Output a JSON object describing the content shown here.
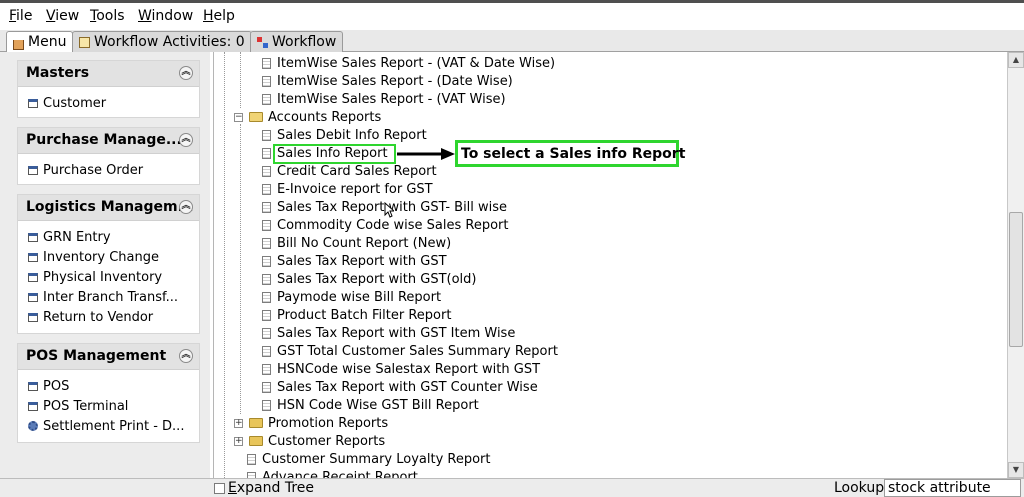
{
  "menubar": {
    "items": [
      {
        "first": "F",
        "rest": "ile"
      },
      {
        "first": "V",
        "rest": "iew"
      },
      {
        "first": "T",
        "rest": "ools"
      },
      {
        "first": "W",
        "rest": "indow"
      },
      {
        "first": "H",
        "rest": "elp"
      }
    ]
  },
  "tabs": [
    {
      "label": "Menu",
      "icon": "home-icon"
    },
    {
      "label": "Workflow Activities: 0",
      "icon": "calendar-icon"
    },
    {
      "label": "Workflow",
      "icon": "workflow-icon"
    }
  ],
  "sidebar": {
    "panels": [
      {
        "title": "Masters",
        "items": [
          {
            "label": "Customer"
          }
        ]
      },
      {
        "title": "Purchase Manage...",
        "items": [
          {
            "label": "Purchase Order"
          }
        ]
      },
      {
        "title": "Logistics Managem...",
        "items": [
          {
            "label": "GRN Entry"
          },
          {
            "label": "Inventory Change"
          },
          {
            "label": "Physical Inventory"
          },
          {
            "label": "Inter Branch Transf..."
          },
          {
            "label": "Return to Vendor"
          }
        ]
      },
      {
        "title": "POS Management",
        "items": [
          {
            "label": "POS"
          },
          {
            "label": "POS Terminal"
          },
          {
            "label": "Settlement Print - D..."
          }
        ]
      }
    ]
  },
  "tree": {
    "item_reports_tail": [
      "ItemWise Sales Report - (VAT & Date Wise)",
      "ItemWise Sales Report - (Date Wise)",
      "ItemWise Sales Report - (VAT Wise)"
    ],
    "accounts_folder": "Accounts Reports",
    "accounts_items": [
      "Sales Debit Info Report",
      "Sales Info Report",
      "Credit Card Sales Report",
      "E-Invoice report for GST",
      "Sales Tax Report with GST- Bill wise",
      "Commodity Code wise Sales Report",
      "Bill No Count Report (New)",
      "Sales Tax Report with GST",
      "Sales Tax Report with GST(old)",
      "Paymode wise Bill Report",
      "Product Batch Filter Report",
      "Sales Tax Report with GST Item Wise",
      "GST Total Customer Sales Summary Report",
      "HSNCode wise Salestax Report with GST",
      "Sales Tax Report with GST Counter Wise",
      "HSN Code Wise GST Bill Report"
    ],
    "collapsed_folders": [
      "Promotion Reports",
      "Customer Reports"
    ],
    "bottom_items": [
      "Customer Summary Loyalty Report",
      "Advance Receipt Report"
    ]
  },
  "annotation": {
    "text": "To select a Sales info Report",
    "color": "#2ed52e"
  },
  "statusbar": {
    "expand_first": "E",
    "expand_rest": "xpand Tree",
    "lookup_label": "Lookup",
    "lookup_value": "stock attribute"
  }
}
